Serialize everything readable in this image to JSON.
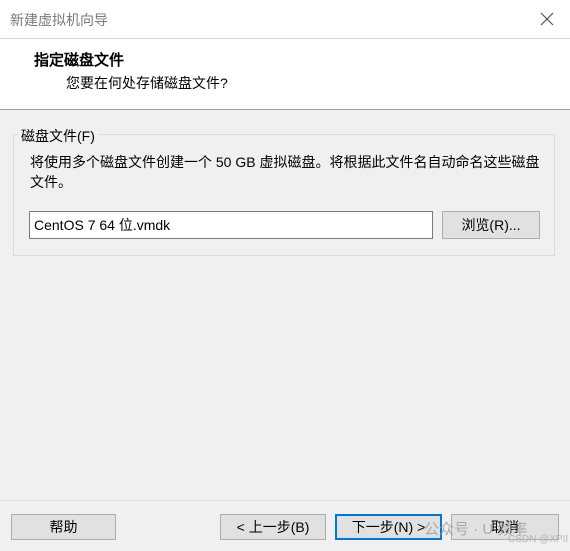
{
  "window": {
    "title": "新建虚拟机向导",
    "close_icon": "close-icon"
  },
  "header": {
    "title": "指定磁盘文件",
    "subtitle": "您要在何处存储磁盘文件?"
  },
  "disk_file": {
    "group_label": "磁盘文件(F)",
    "description": "将使用多个磁盘文件创建一个 50 GB 虚拟磁盘。将根据此文件名自动命名这些磁盘文件。",
    "path_value": "CentOS 7 64 位.vmdk",
    "browse_label": "浏览(R)..."
  },
  "footer": {
    "help_label": "帮助",
    "back_label": "< 上一步(B)",
    "next_label": "下一步(N) >",
    "cancel_label": "取消"
  },
  "watermark": {
    "text": "公众号 · U    频率",
    "sub": "CSDN @XPII"
  },
  "colors": {
    "accent": "#0078d7",
    "background": "#f0f0f0"
  }
}
